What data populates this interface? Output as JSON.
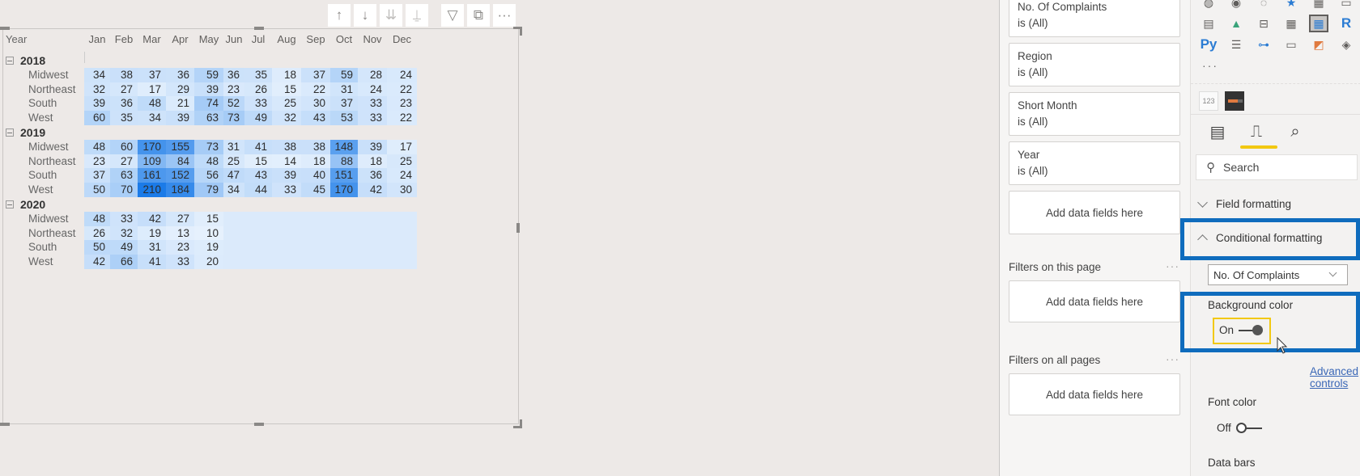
{
  "visual_header": {
    "buttons": [
      {
        "name": "drill-up-button",
        "glyph": "↑",
        "icon": "arrow-up-icon"
      },
      {
        "name": "drill-down-button",
        "glyph": "↓",
        "icon": "arrow-down-icon"
      },
      {
        "name": "next-level-button",
        "glyph": "⇊",
        "icon": "double-arrow-down-icon"
      },
      {
        "name": "expand-hierarchy-button",
        "glyph": "⍊",
        "icon": "fork-down-icon"
      },
      {
        "name": "filter-button",
        "glyph": "▽",
        "icon": "filter-icon"
      },
      {
        "name": "focus-mode-button",
        "glyph": "⧉",
        "icon": "focus-mode-icon"
      },
      {
        "name": "more-options-button",
        "glyph": "···",
        "icon": "more-icon"
      }
    ]
  },
  "matrix": {
    "row_header": "Year",
    "months": [
      "Jan",
      "Feb",
      "Mar",
      "Apr",
      "May",
      "Jun",
      "Jul",
      "Aug",
      "Sep",
      "Oct",
      "Nov",
      "Dec"
    ],
    "color_scale": {
      "low": "#e6f1fd",
      "high": "#1b7be8",
      "min": 10,
      "max": 210
    },
    "groups": [
      {
        "year": "2018",
        "rows": [
          {
            "region": "Midwest",
            "values": [
              34,
              38,
              37,
              36,
              59,
              36,
              35,
              18,
              37,
              59,
              28,
              24
            ]
          },
          {
            "region": "Northeast",
            "values": [
              32,
              27,
              17,
              29,
              39,
              23,
              26,
              15,
              22,
              31,
              24,
              22
            ]
          },
          {
            "region": "South",
            "values": [
              39,
              36,
              48,
              21,
              74,
              52,
              33,
              25,
              30,
              37,
              33,
              23
            ]
          },
          {
            "region": "West",
            "values": [
              60,
              35,
              34,
              39,
              63,
              73,
              49,
              32,
              43,
              53,
              33,
              22
            ]
          }
        ]
      },
      {
        "year": "2019",
        "rows": [
          {
            "region": "Midwest",
            "values": [
              48,
              60,
              170,
              155,
              73,
              31,
              41,
              38,
              38,
              148,
              39,
              17
            ]
          },
          {
            "region": "Northeast",
            "values": [
              23,
              27,
              109,
              84,
              48,
              25,
              15,
              14,
              18,
              88,
              18,
              25
            ]
          },
          {
            "region": "South",
            "values": [
              37,
              63,
              161,
              152,
              56,
              47,
              43,
              39,
              40,
              151,
              36,
              24
            ]
          },
          {
            "region": "West",
            "values": [
              50,
              70,
              210,
              184,
              79,
              34,
              44,
              33,
              45,
              170,
              42,
              30
            ]
          }
        ]
      },
      {
        "year": "2020",
        "rows": [
          {
            "region": "Midwest",
            "values": [
              48,
              33,
              42,
              27,
              15,
              null,
              null,
              null,
              null,
              null,
              null,
              null
            ]
          },
          {
            "region": "Northeast",
            "values": [
              26,
              32,
              19,
              13,
              10,
              null,
              null,
              null,
              null,
              null,
              null,
              null
            ]
          },
          {
            "region": "South",
            "values": [
              50,
              49,
              31,
              23,
              19,
              null,
              null,
              null,
              null,
              null,
              null,
              null
            ]
          },
          {
            "region": "West",
            "values": [
              42,
              66,
              41,
              33,
              20,
              null,
              null,
              null,
              null,
              null,
              null,
              null
            ]
          }
        ]
      }
    ]
  },
  "filters": {
    "visual_filters": [
      {
        "field": "No. Of Complaints",
        "value": "is (All)"
      },
      {
        "field": "Region",
        "value": "is (All)"
      },
      {
        "field": "Short Month",
        "value": "is (All)"
      },
      {
        "field": "Year",
        "value": "is (All)"
      }
    ],
    "add_fields_label": "Add data fields here",
    "page_section": "Filters on this page",
    "all_pages_section": "Filters on all pages",
    "more": "···"
  },
  "viz_pane": {
    "more": "···",
    "custom_visual_label": "123",
    "tabs": [
      {
        "name": "fields-tab",
        "glyph": "▤",
        "icon": "fields-icon"
      },
      {
        "name": "format-tab",
        "glyph": "🖌",
        "icon": "paint-roller-icon"
      },
      {
        "name": "analytics-tab",
        "glyph": "🔍",
        "icon": "analytics-icon"
      }
    ],
    "search_placeholder": "Search",
    "field_formatting": "Field formatting",
    "conditional_formatting": "Conditional formatting",
    "field_dropdown": "No. Of Complaints",
    "background_color": {
      "label": "Background color",
      "state": "On"
    },
    "advanced_controls": "Advanced controls",
    "font_color": {
      "label": "Font color",
      "state": "Off"
    },
    "data_bars": {
      "label": "Data bars"
    },
    "highlight_color": "#0f6cbd"
  }
}
